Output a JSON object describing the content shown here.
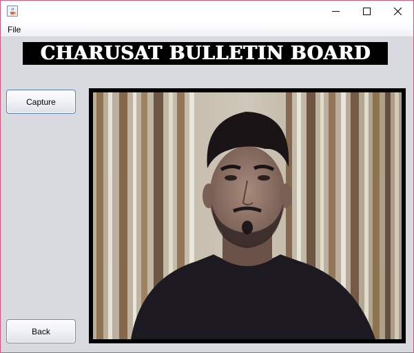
{
  "window": {
    "icon": "java-coffee-icon",
    "controls": [
      "minimize-icon",
      "maximize-icon",
      "close-icon"
    ]
  },
  "menubar": {
    "items": [
      {
        "label": "File"
      }
    ]
  },
  "banner": {
    "title": "CHARUSAT BULLETIN BOARD"
  },
  "buttons": {
    "capture": "Capture",
    "back": "Back"
  },
  "camera": {
    "content": "webcam-live-feed"
  },
  "colors": {
    "window_border": "#d3557a",
    "background": "#d8dae0",
    "banner_bg": "#000000",
    "banner_text": "#ffffff",
    "frame": "#000000"
  }
}
